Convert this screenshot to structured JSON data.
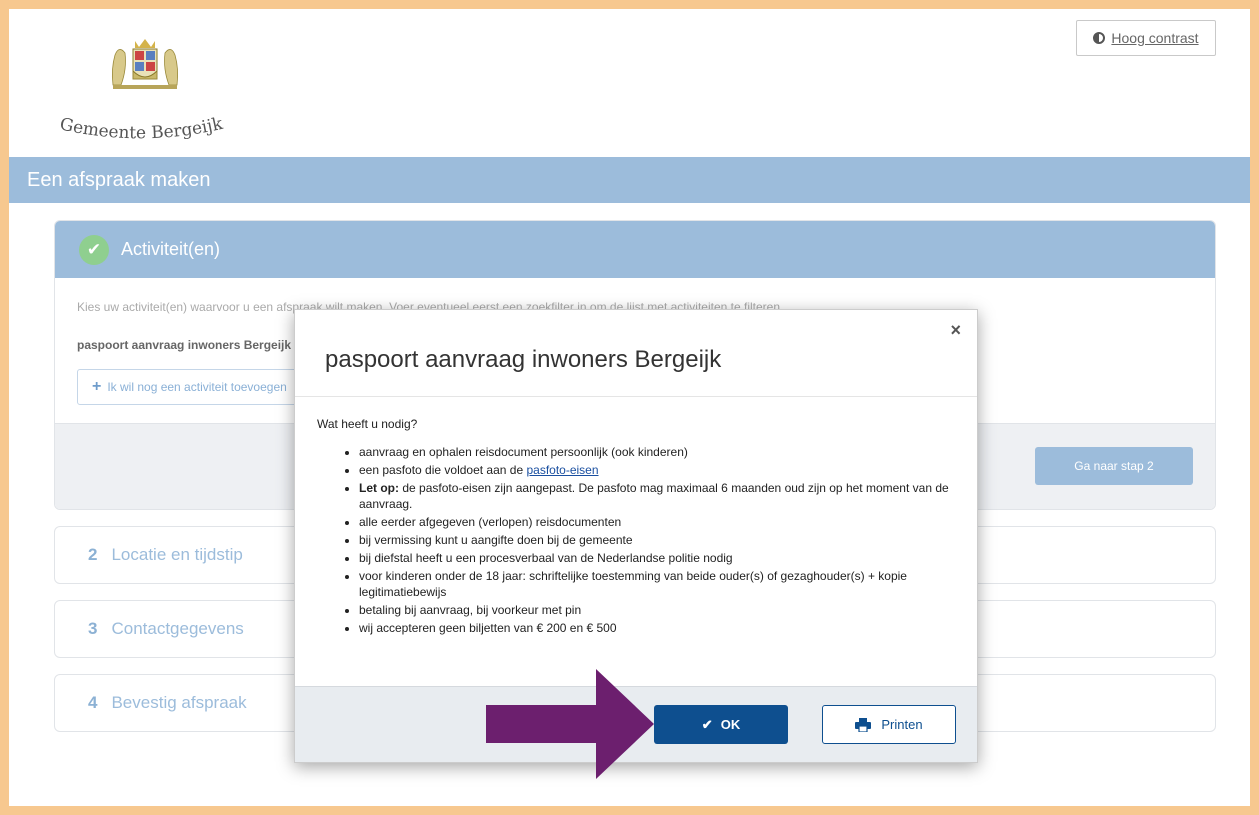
{
  "header": {
    "logo_text": "Gemeente Bergeijk",
    "contrast_button": "Hoog contrast"
  },
  "page_title": "Een afspraak maken",
  "step1": {
    "title": "Activiteit(en)",
    "instructions": "Kies uw activiteit(en) waarvoor u een afspraak wilt maken. Voer eventueel eerst een zoekfilter in om de lijst met activiteiten te filteren.",
    "selected_activity": "paspoort aanvraag inwoners Bergeijk",
    "add_activity": "Ik wil nog een activiteit toevoegen",
    "next_button": "Ga naar stap 2"
  },
  "steps": [
    {
      "number": "2",
      "label": "Locatie en tijdstip"
    },
    {
      "number": "3",
      "label": "Contactgegevens"
    },
    {
      "number": "4",
      "label": "Bevestig afspraak"
    }
  ],
  "modal": {
    "title": "paspoort aanvraag inwoners Bergeijk",
    "close": "×",
    "intro": "Wat heeft u nodig?",
    "items": {
      "item0": "aanvraag en ophalen reisdocument persoonlijk  (ook kinderen)",
      "item1_prefix": "een pasfoto die voldoet aan de ",
      "item1_link": "pasfoto-eisen",
      "item2_bold": "Let op:",
      "item2_rest": " de pasfoto-eisen zijn aangepast. De pasfoto mag maximaal 6 maanden oud zijn op het moment van de aanvraag.",
      "item3": "alle eerder afgegeven (verlopen) reisdocumenten",
      "item4": "bij vermissing kunt u aangifte doen bij de gemeente",
      "item5": "bij diefstal heeft u een procesverbaal van de Nederlandse politie nodig",
      "item6": "voor kinderen onder de 18 jaar: schriftelijke toestemming van beide ouder(s) of gezaghouder(s) + kopie legitimatiebewijs",
      "item7": "betaling bij aanvraag, bij voorkeur met pin",
      "item8": "wij accepteren geen biljetten van € 200 en € 500"
    },
    "ok_button": "OK",
    "print_button": "Printen"
  },
  "colors": {
    "accent": "#9cbcdb",
    "primary": "#0e4f8f",
    "arrow": "#6c1f6e",
    "frame": "#f7c88f"
  }
}
